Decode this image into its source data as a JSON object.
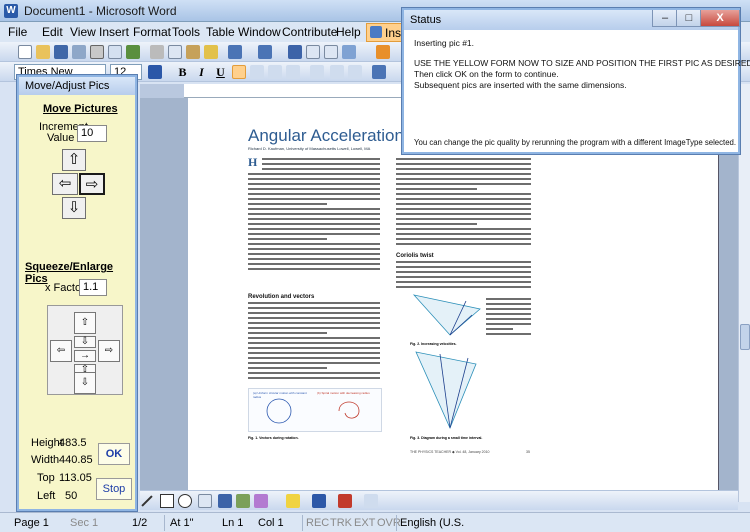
{
  "word": {
    "title": "Document1 - Microsoft Word",
    "menu": {
      "file": "File",
      "edit": "Edit",
      "view": "View",
      "insert": "Insert",
      "format": "Format",
      "tools": "Tools",
      "table": "Table",
      "window": "Window",
      "contribute": "Contribute",
      "help": "Help",
      "insert_toolbar": "Insert"
    },
    "format_toolbar": {
      "font_name": "Times New Roman",
      "font_size": "12",
      "bold": "B",
      "italic": "I",
      "underline": "U"
    },
    "status_bar": {
      "page": "Page 1",
      "sec": "Sec 1",
      "pages": "1/2",
      "at": "At 1\"",
      "ln": "Ln 1",
      "col": "Col 1",
      "rec": "REC",
      "trk": "TRK",
      "ext": "EXT",
      "ovr": "OVR",
      "language": "English (U.S."
    }
  },
  "document": {
    "title": "Angular Acceleration Without",
    "byline": "Richard D. Kaufman, University of Massachusetts Lowell, Lowell, MA",
    "section_revolution": "Revolution and vectors",
    "section_coriolis": "Coriolis twist",
    "fig1_caption": "Fig. 1. Vectors during rotation.",
    "fig2_caption": "Fig. 2. Increasing velocities.",
    "fig3_caption": "Fig. 3. Diagram during a small time interval.",
    "fig1_label_a": "(a) Uniform circular motion with constant radius",
    "fig1_label_b": "(b) Spiral motion with decreasing radius",
    "footer": "THE PHYSICS TEACHER ◆ Vol. 48, January 2010",
    "page_number": "35"
  },
  "move_dialog": {
    "title": "Move/Adjust Pics",
    "move_heading": "Move Pictures",
    "increment_label": "Increment",
    "value_label": "Value",
    "increment_value": "10",
    "squeeze_heading": "Squeeze/Enlarge Pics",
    "xfactor_label": "x Factor",
    "xfactor_value": "1.1",
    "height_label": "Height",
    "height_value": "483.5",
    "width_label": "Width",
    "width_value": "440.85",
    "top_label": "Top",
    "top_value": "113.05",
    "left_label": "Left",
    "left_value": "50",
    "ok_label": "OK",
    "stop_label": "Stop"
  },
  "status_dialog": {
    "title": "Status",
    "line1": "Inserting pic #1.",
    "line2": "USE THE YELLOW FORM NOW TO SIZE AND POSITION THE FIRST PIC AS DESIRED.",
    "line3": "Then click OK on the form to continue.",
    "line4": "Subsequent pics are inserted with the same dimensions.",
    "line5": "You can change the pic quality by rerunning the program with a different ImageType selected.",
    "minimize": "–",
    "restore": "□",
    "close": "X"
  },
  "colors": {
    "title_blue": "#2e5c91",
    "dialog_bg": "#f7f6c9",
    "insert_highlight": "#ffd08c",
    "close_red": "#c7493e"
  },
  "icons": [
    "word-app-icon",
    "new-icon",
    "open-icon",
    "save-icon",
    "print-icon",
    "arrow-up-icon",
    "arrow-left-icon",
    "arrow-right-icon",
    "arrow-down-icon"
  ]
}
